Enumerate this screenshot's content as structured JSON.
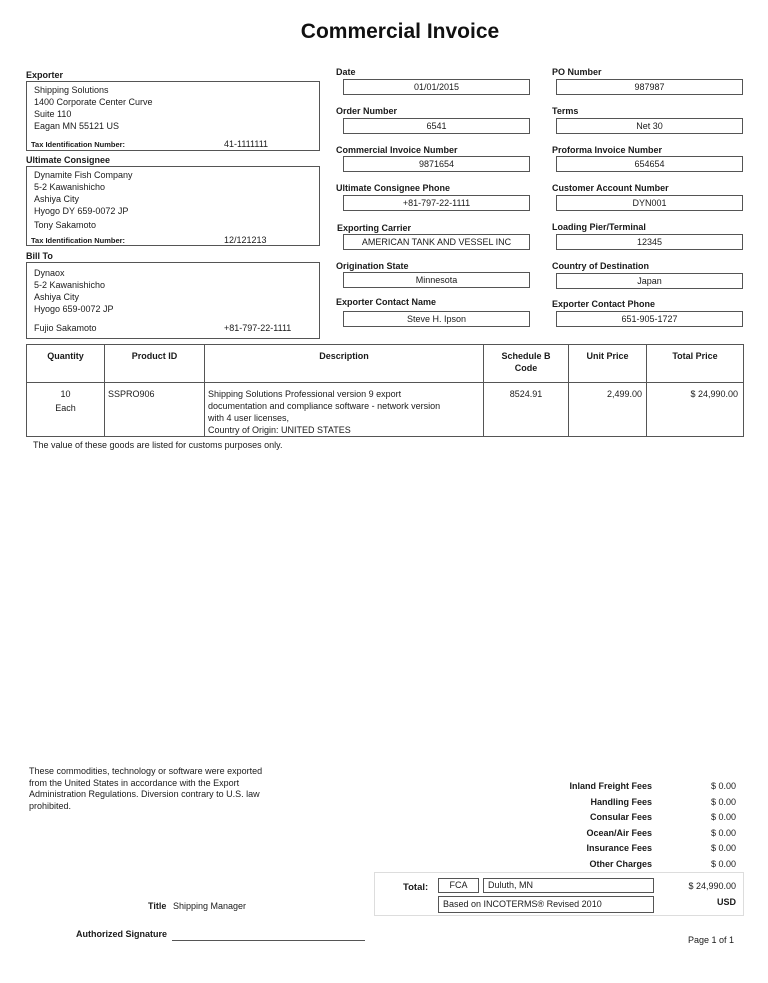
{
  "document": {
    "title": "Commercial Invoice",
    "page": "Page 1 of 1"
  },
  "exporter": {
    "label": "Exporter",
    "lines": [
      "Shipping Solutions",
      "1400 Corporate Center Curve",
      "Suite 110",
      "Eagan MN 55121 US"
    ],
    "tax_label": "Tax Identification Number:",
    "tax_value": "41-1111111"
  },
  "consignee": {
    "label": "Ultimate Consignee",
    "lines": [
      "Dynamite Fish Company",
      "5-2 Kawanishicho",
      "Ashiya City",
      "Hyogo DY 659-0072 JP"
    ],
    "contact": "Tony Sakamoto",
    "tax_label": "Tax Identification Number:",
    "tax_value": "12/121213"
  },
  "bill_to": {
    "label": "Bill To",
    "lines": [
      "Dynaox",
      "5-2 Kawanishicho",
      "Ashiya City",
      "Hyogo  659-0072 JP"
    ],
    "contact": "Fujio Sakamoto",
    "phone": "+81-797-22-1111"
  },
  "fields": {
    "date": {
      "label": "Date",
      "value": "01/01/2015"
    },
    "po_number": {
      "label": "PO Number",
      "value": "987987"
    },
    "order_number": {
      "label": "Order Number",
      "value": "6541"
    },
    "terms": {
      "label": "Terms",
      "value": "Net 30"
    },
    "commercial_invoice_number": {
      "label": "Commercial Invoice Number",
      "value": "9871654"
    },
    "proforma_invoice_number": {
      "label": "Proforma Invoice Number",
      "value": "654654"
    },
    "consignee_phone": {
      "label": "Ultimate Consignee Phone",
      "value": "+81-797-22-1111"
    },
    "customer_account_number": {
      "label": "Customer Account Number",
      "value": "DYN001"
    },
    "exporting_carrier": {
      "label": "Exporting Carrier",
      "value": "AMERICAN TANK AND VESSEL INC"
    },
    "loading_pier": {
      "label": "Loading Pier/Terminal",
      "value": "12345"
    },
    "origination_state": {
      "label": "Origination State",
      "value": "Minnesota"
    },
    "country_of_destination": {
      "label": "Country of Destination",
      "value": "Japan"
    },
    "exporter_contact_name": {
      "label": "Exporter Contact Name",
      "value": "Steve H. Ipson"
    },
    "exporter_contact_phone": {
      "label": "Exporter Contact Phone",
      "value": "651-905-1727"
    }
  },
  "items_table": {
    "headers": {
      "quantity": "Quantity",
      "product_id": "Product ID",
      "description": "Description",
      "schedule_b_1": "Schedule B",
      "schedule_b_2": "Code",
      "unit_price": "Unit Price",
      "total_price": "Total Price"
    },
    "rows": [
      {
        "quantity": "10",
        "unit": "Each",
        "product_id": "SSPRO906",
        "description": [
          "Shipping Solutions Professional version 9 export",
          "documentation and compliance software - network version",
          "with 4 user licenses,",
          "Country of Origin: UNITED STATES"
        ],
        "schedule_b": "8524.91",
        "unit_price": "2,499.00",
        "total_price": "$ 24,990.00"
      }
    ],
    "note": "The value of these goods are listed for customs purposes only."
  },
  "export_statement": [
    "These commodities, technology or software were exported",
    "from the United States in accordance with the Export",
    "Administration Regulations. Diversion contrary to U.S. law",
    "prohibited."
  ],
  "fees": [
    {
      "label": "Inland Freight Fees",
      "value": "$ 0.00"
    },
    {
      "label": "Handling Fees",
      "value": "$ 0.00"
    },
    {
      "label": "Consular Fees",
      "value": "$ 0.00"
    },
    {
      "label": "Ocean/Air Fees",
      "value": "$ 0.00"
    },
    {
      "label": "Insurance Fees",
      "value": "$ 0.00"
    },
    {
      "label": "Other Charges",
      "value": "$ 0.00"
    }
  ],
  "total": {
    "label": "Total:",
    "incoterm": "FCA",
    "place": "Duluth, MN",
    "incoterms_note": "Based on INCOTERMS® Revised 2010",
    "amount": "$ 24,990.00",
    "currency": "USD"
  },
  "signature": {
    "title_label": "Title",
    "title_value": "Shipping Manager",
    "signature_label": "Authorized Signature"
  }
}
